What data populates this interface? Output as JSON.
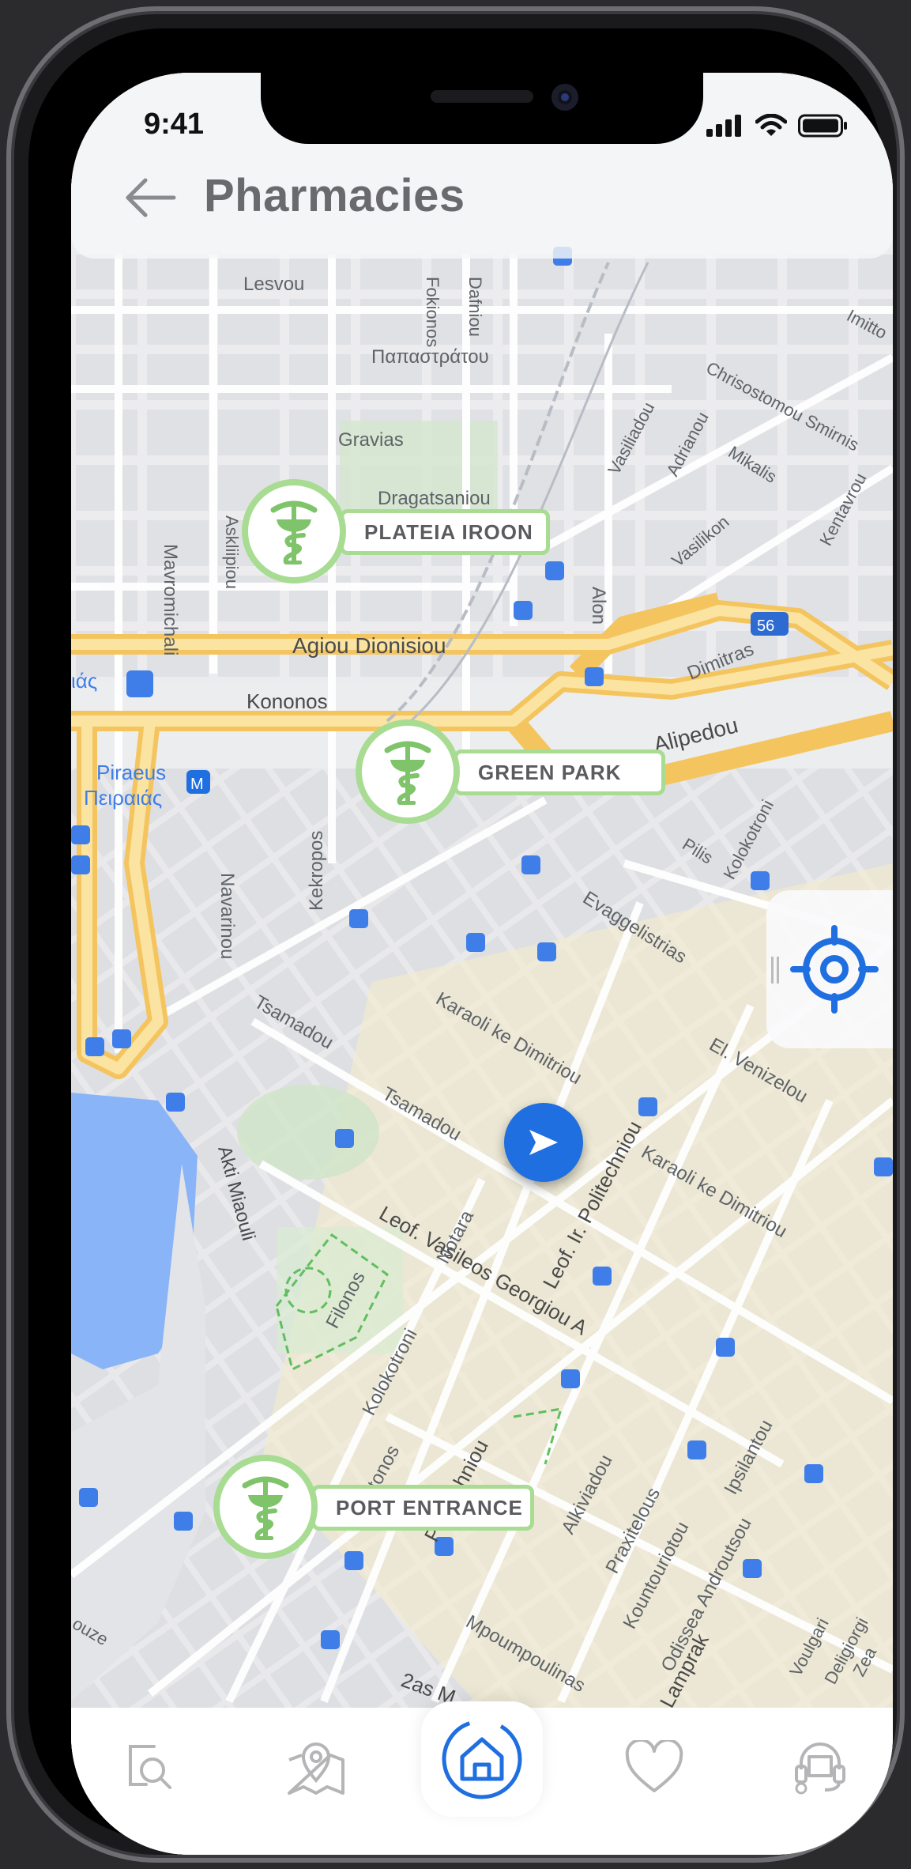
{
  "status_bar": {
    "time": "9:41"
  },
  "header": {
    "title": "Pharmacies",
    "back_icon": "arrow-left-icon"
  },
  "map": {
    "street_labels": [
      "Lesvou",
      "Παπαστράτου",
      "Gravias",
      "Dragatsaniou",
      "Agiou Dionisiou",
      "Kononos",
      "Alipedou",
      "Dimitras",
      "Piraeus",
      "Πειραιάς",
      "Navarinou",
      "Kekropos",
      "Tsamadou",
      "Karaoli ke Dimitriou",
      "Akti Miaouli",
      "Leof. Vasileos Georgiou A",
      "Leof. Ir. Politechniou",
      "El. Venizelou",
      "Notara",
      "Filonos",
      "Kolokotroni",
      "Platonos",
      "Politechniou",
      "Alkiviadou",
      "Praxitelous",
      "Kountouriotou",
      "Odissea Androutsou",
      "Ipsilantou",
      "Mpoumpoulinas",
      "Evaggelistrias",
      "Pilis",
      "Mavromichali",
      "Askliipiou",
      "Vasiliadou",
      "Adrianou",
      "Mikalis",
      "Vasilikon",
      "Kentavrou",
      "Chrisostomou Smirnis",
      "Alon",
      "Dafniou",
      "Fokionos",
      "Voulgari",
      "Deligiorgi",
      "2as M",
      "Imitto",
      "Lamprak",
      "ιάς",
      "56",
      "M",
      "Zea",
      "ouze"
    ],
    "accent_color": "#1f6fe0",
    "pharmacy_color": "#a8dc92"
  },
  "pharmacies": [
    {
      "name": "PLATEIA IROON",
      "icon": "pharmacy-caduceus-icon"
    },
    {
      "name": "GREEN PARK",
      "icon": "pharmacy-caduceus-icon"
    },
    {
      "name": "PORT ENTRANCE",
      "icon": "pharmacy-caduceus-icon"
    }
  ],
  "controls": {
    "locate_icon": "crosshair-icon",
    "my_location_icon": "navigation-arrow-icon"
  },
  "tab_bar": {
    "tabs": [
      {
        "name": "search",
        "icon": "search-icon"
      },
      {
        "name": "map",
        "icon": "map-pin-icon"
      },
      {
        "name": "home",
        "icon": "home-icon",
        "active": true
      },
      {
        "name": "favorites",
        "icon": "heart-icon"
      },
      {
        "name": "support",
        "icon": "headset-icon"
      }
    ]
  }
}
